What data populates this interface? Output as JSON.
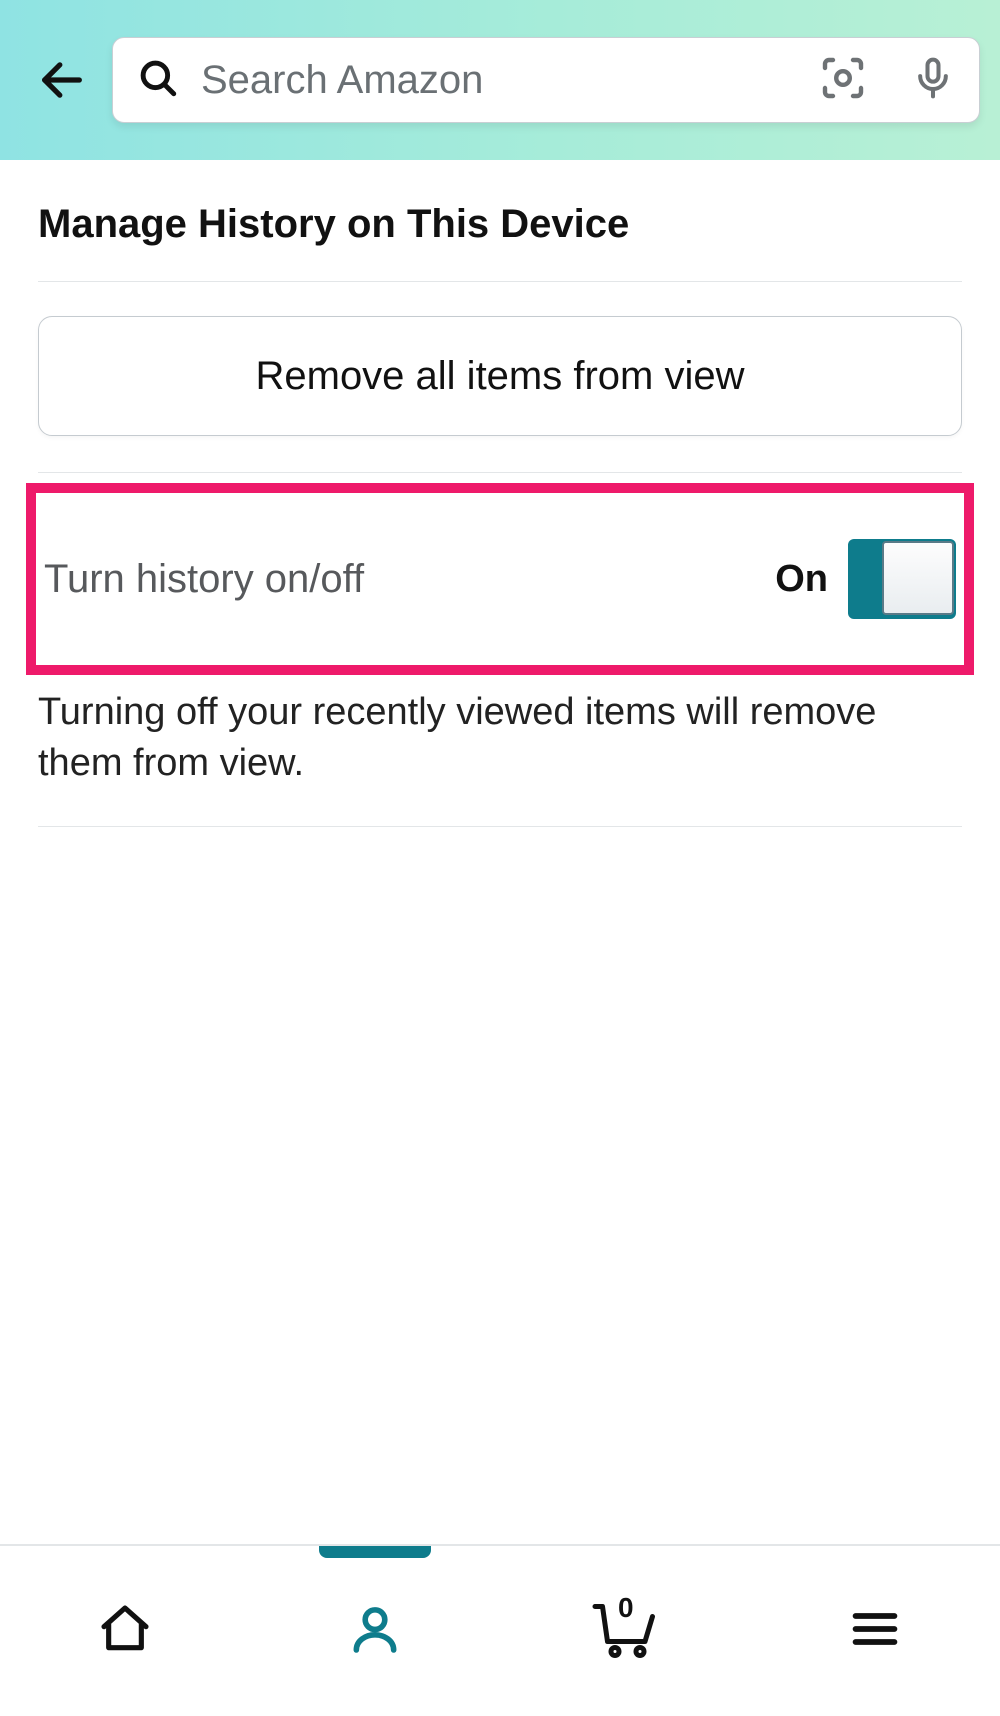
{
  "header": {
    "search_placeholder": "Search Amazon"
  },
  "page": {
    "title": "Manage History on This Device",
    "remove_button_label": "Remove all items from view",
    "toggle_label": "Turn history on/off",
    "toggle_state": "On",
    "help_text": "Turning off your recently viewed items will remove them from view."
  },
  "nav": {
    "cart_count": "0"
  },
  "colors": {
    "accent": "#0e7c8c",
    "highlight": "#ee1a6a"
  }
}
